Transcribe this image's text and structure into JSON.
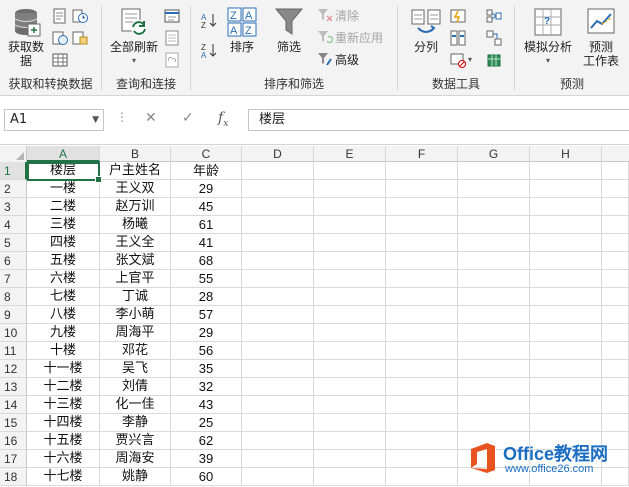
{
  "ribbon": {
    "groups": [
      {
        "label": "获取和转换数据",
        "big": {
          "label1": "获取数",
          "label2": "据"
        }
      },
      {
        "label": "查询和连接",
        "big": {
          "label": "全部刷新"
        }
      },
      {
        "label": "排序和筛选",
        "sort": "排序",
        "filter": "筛选",
        "clear": "清除",
        "reapply": "重新应用",
        "advanced": "高级"
      },
      {
        "label": "数据工具",
        "split": "分列"
      },
      {
        "label": "预测",
        "whatif": "模拟分析",
        "forecast1": "预测",
        "forecast2": "工作表"
      }
    ]
  },
  "formula_bar": {
    "name_box": "A1",
    "content": "楼层"
  },
  "grid": {
    "columns": [
      "A",
      "B",
      "C",
      "D",
      "E",
      "F",
      "G",
      "H"
    ],
    "rows": [
      {
        "n": "1",
        "a": "楼层",
        "b": "户主姓名",
        "c": "年龄"
      },
      {
        "n": "2",
        "a": "一楼",
        "b": "王义双",
        "c": "29"
      },
      {
        "n": "3",
        "a": "二楼",
        "b": "赵万训",
        "c": "45"
      },
      {
        "n": "4",
        "a": "三楼",
        "b": "杨曦",
        "c": "61"
      },
      {
        "n": "5",
        "a": "四楼",
        "b": "王义全",
        "c": "41"
      },
      {
        "n": "6",
        "a": "五楼",
        "b": "张文斌",
        "c": "68"
      },
      {
        "n": "7",
        "a": "六楼",
        "b": "上官平",
        "c": "55"
      },
      {
        "n": "8",
        "a": "七楼",
        "b": "丁诚",
        "c": "28"
      },
      {
        "n": "9",
        "a": "八楼",
        "b": "李小萌",
        "c": "57"
      },
      {
        "n": "10",
        "a": "九楼",
        "b": "周海平",
        "c": "29"
      },
      {
        "n": "11",
        "a": "十楼",
        "b": "邓花",
        "c": "56"
      },
      {
        "n": "12",
        "a": "十一楼",
        "b": "吴飞",
        "c": "35"
      },
      {
        "n": "13",
        "a": "十二楼",
        "b": "刘倩",
        "c": "32"
      },
      {
        "n": "14",
        "a": "十三楼",
        "b": "化一佳",
        "c": "43"
      },
      {
        "n": "15",
        "a": "十四楼",
        "b": "李静",
        "c": "25"
      },
      {
        "n": "16",
        "a": "十五楼",
        "b": "贾兴言",
        "c": "62"
      },
      {
        "n": "17",
        "a": "十六楼",
        "b": "周海安",
        "c": "39"
      },
      {
        "n": "18",
        "a": "十七楼",
        "b": "姚静",
        "c": "60"
      }
    ]
  },
  "watermark": {
    "title": "Office教程网",
    "url": "www.office26.com"
  },
  "colors": {
    "accent": "#217346",
    "watermark": "#1b6ec2"
  }
}
